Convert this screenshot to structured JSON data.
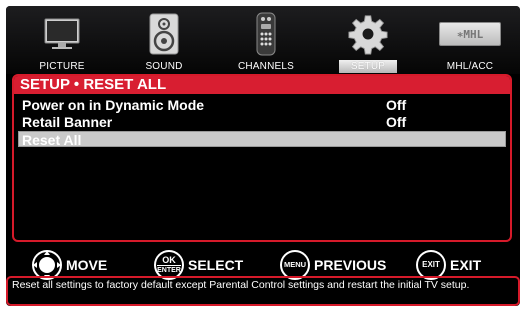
{
  "categories": [
    {
      "label": "PICTURE",
      "icon": "tv-icon",
      "active": false
    },
    {
      "label": "SOUND",
      "icon": "speaker-icon",
      "active": false
    },
    {
      "label": "CHANNELS",
      "icon": "remote-icon",
      "active": false
    },
    {
      "label": "SETUP",
      "icon": "gear-icon",
      "active": true
    },
    {
      "label": "MHL/ACC",
      "icon": "mhl-logo",
      "mhl_text": "∗MHL",
      "active": false
    }
  ],
  "panel": {
    "title": "SETUP • RESET ALL",
    "rows": [
      {
        "label": "Power on in Dynamic Mode",
        "value": "Off",
        "selected": false
      },
      {
        "label": "Retail Banner",
        "value": "Off",
        "selected": false
      },
      {
        "label": "Reset All",
        "value": "",
        "selected": true
      }
    ]
  },
  "nav": {
    "move": "MOVE",
    "ok_top": "OK",
    "ok_bottom": "ENTER",
    "select": "SELECT",
    "menu_btn": "MENU",
    "previous": "PREVIOUS",
    "exit_btn": "EXIT",
    "exit": "EXIT"
  },
  "help_text": "Reset all settings to factory default except Parental Control settings and restart the initial TV setup.",
  "colors": {
    "accent": "#d81e31",
    "background": "#000000",
    "selection": "#c9c9c9"
  }
}
